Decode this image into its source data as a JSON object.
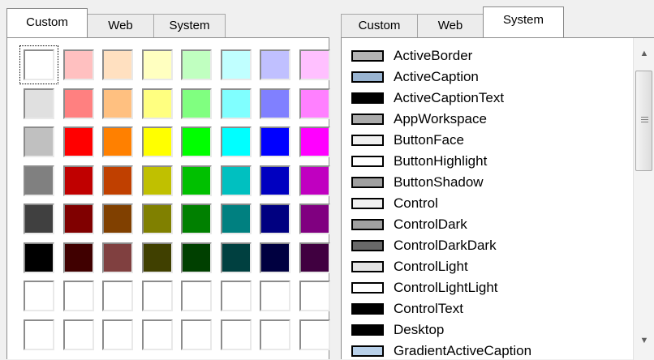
{
  "left_tabs": [
    "Custom",
    "Web",
    "System"
  ],
  "left_active_tab": "Custom",
  "right_tabs": [
    "Custom",
    "Web",
    "System"
  ],
  "right_active_tab": "System",
  "custom_colors": [
    [
      "#ffffff",
      "#ffc0c0",
      "#ffe0c0",
      "#ffffc0",
      "#c0ffc0",
      "#c0ffff",
      "#c0c0ff",
      "#ffc0ff"
    ],
    [
      "#e0e0e0",
      "#ff8080",
      "#ffc080",
      "#ffff80",
      "#80ff80",
      "#80ffff",
      "#8080ff",
      "#ff80ff"
    ],
    [
      "#c0c0c0",
      "#ff0000",
      "#ff8000",
      "#ffff00",
      "#00ff00",
      "#00ffff",
      "#0000ff",
      "#ff00ff"
    ],
    [
      "#808080",
      "#c00000",
      "#c04000",
      "#c0c000",
      "#00c000",
      "#00c0c0",
      "#0000c0",
      "#c000c0"
    ],
    [
      "#404040",
      "#800000",
      "#804000",
      "#808000",
      "#008000",
      "#008080",
      "#000080",
      "#800080"
    ],
    [
      "#000000",
      "#400000",
      "#804040",
      "#404000",
      "#004000",
      "#004040",
      "#000040",
      "#400040"
    ],
    [
      "#ffffff",
      "#ffffff",
      "#ffffff",
      "#ffffff",
      "#ffffff",
      "#ffffff",
      "#ffffff",
      "#ffffff"
    ],
    [
      "#ffffff",
      "#ffffff",
      "#ffffff",
      "#ffffff",
      "#ffffff",
      "#ffffff",
      "#ffffff",
      "#ffffff"
    ]
  ],
  "selected_custom_swatch": {
    "row": 0,
    "col": 0
  },
  "system_colors": [
    {
      "name": "ActiveBorder",
      "color": "#b4b4b4"
    },
    {
      "name": "ActiveCaption",
      "color": "#99b4d1"
    },
    {
      "name": "ActiveCaptionText",
      "color": "#000000"
    },
    {
      "name": "AppWorkspace",
      "color": "#ababab"
    },
    {
      "name": "ButtonFace",
      "color": "#f0f0f0"
    },
    {
      "name": "ButtonHighlight",
      "color": "#ffffff"
    },
    {
      "name": "ButtonShadow",
      "color": "#a0a0a0"
    },
    {
      "name": "Control",
      "color": "#f0f0f0"
    },
    {
      "name": "ControlDark",
      "color": "#a0a0a0"
    },
    {
      "name": "ControlDarkDark",
      "color": "#696969"
    },
    {
      "name": "ControlLight",
      "color": "#e3e3e3"
    },
    {
      "name": "ControlLightLight",
      "color": "#ffffff"
    },
    {
      "name": "ControlText",
      "color": "#000000"
    },
    {
      "name": "Desktop",
      "color": "#000000"
    },
    {
      "name": "GradientActiveCaption",
      "color": "#b9d1ea"
    }
  ],
  "scrollbar": {
    "up_icon": "arrow-up-icon",
    "down_icon": "arrow-down-icon",
    "thumb_icon": "scroll-grip-icon",
    "position_fraction": 0.0
  }
}
